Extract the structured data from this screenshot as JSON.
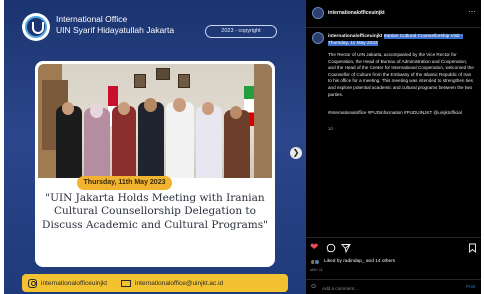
{
  "post_image": {
    "office_line1": "International Office",
    "office_line2": "UIN Syarif Hidayatullah Jakarta",
    "copyright": "2023 - copyright",
    "date": "Thursday, 11th May 2023",
    "headline": "\"UIN Jakarta Holds Meeting with Iranian Cultural Counsellorship Delegation to Discuss Academic and Cultural Programs\"",
    "instagram_handle": "internationalofficeuinjkt",
    "email": "internationaloffice@uinjkt.ac.id",
    "colors": {
      "navy": "#1b3470",
      "yellow": "#f2b430"
    }
  },
  "panel": {
    "username": "internationalofficeuinjkt",
    "caption_username": "internationalofficeuinjkt",
    "caption_title": "Iranian Cultural Counsellorship Visit - Thursday, 11 May 2023",
    "caption_body": "The Rector of UIN Jakarta, accompanied by the Vice Rector for Cooperation, the Head of Bureau of Administration and Cooperation, and the Head of the Center for International Cooperation, welcomed the Counsellor of Culture from the Embassy of the Islamic Republic of Iran to his office for a meeting. This meeting was intended to strengthen ties and explore potential academic and cultural programs between the two parties.",
    "hashtags": "#internationaloffice #PUDinformation #PUDUINJKT @uinjktofficial",
    "time_ago": "1d",
    "likes_text": "Liked by radindap_ and 14 others",
    "date": "MAY 11",
    "comment_placeholder": "Add a comment...",
    "post_label": "Post"
  },
  "icons": {
    "more": "more-options-icon",
    "heart": "heart-icon",
    "comment": "comment-icon",
    "share": "share-icon",
    "bookmark": "bookmark-icon",
    "emoji": "emoji-icon",
    "next": "chevron-right-icon"
  }
}
